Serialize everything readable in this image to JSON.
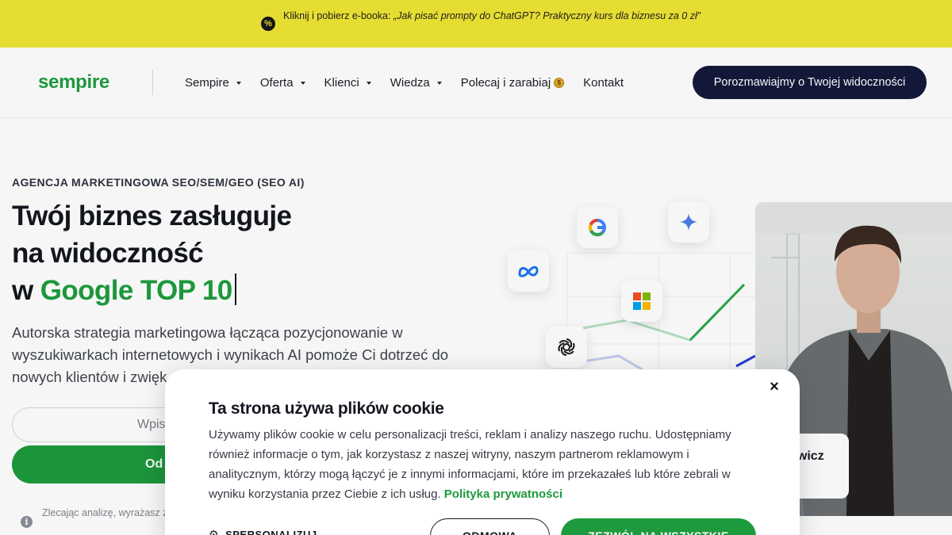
{
  "promo": {
    "icon": "percent-badge-icon",
    "lead": "Kliknij i pobierz e-booka: ",
    "title": "„Jak pisać prompty do ChatGPT? Praktyczny kurs dla biznesu za 0 zł”"
  },
  "header": {
    "logo": "sempire",
    "nav": [
      {
        "label": "Sempire",
        "has_dropdown": true
      },
      {
        "label": "Oferta",
        "has_dropdown": true
      },
      {
        "label": "Klienci",
        "has_dropdown": true
      },
      {
        "label": "Wiedza",
        "has_dropdown": true
      },
      {
        "label": "Polecaj i zarabiaj",
        "has_dropdown": false,
        "icon": "money-bag-icon"
      },
      {
        "label": "Kontakt",
        "has_dropdown": false
      }
    ],
    "cta": "Porozmawiajmy o Twojej widoczności"
  },
  "hero": {
    "eyebrow": "AGENCJA MARKETINGOWA SEO/SEM/GEO (SEO AI)",
    "headline_line1": "Twój biznes zasługuje",
    "headline_line2": "na widoczność",
    "headline_prefix": "w",
    "headline_highlight": "Google TOP 10",
    "lead": "Autorska strategia marketingowa łącząca pozycjonowanie w wyszukiwarkach internetowych i wynikach AI pomoże Ci dotrzeć do nowych klientów i zwięk",
    "input_placeholder": "Wpis",
    "submit_label": "Od",
    "consent_note": "Zlecając analizę, wyrażasz zg specjaliści przedstawią wyn",
    "person_name_fragment": "ewicz",
    "brand_icons": [
      "google-icon",
      "gemini-icon",
      "meta-icon",
      "microsoft-icon",
      "openai-icon"
    ],
    "colors": {
      "accent_green": "#1d9a3d",
      "navy": "#15193b",
      "promo_yellow": "#e6dd33"
    }
  },
  "cookie": {
    "title": "Ta strona używa plików cookie",
    "body": "Używamy plików cookie w celu personalizacji treści, reklam i analizy naszego ruchu. Udostępniamy również informacje o tym, jak korzystasz z naszej witryny, naszym partnerom reklamowym i analitycznym, którzy mogą łączyć je z innymi informacjami, które im przekazałeś lub które zebrali w wyniku korzystania przez Ciebie z ich usług. ",
    "privacy_link": "Polityka prywatności",
    "personalize": "SPERSONALIZUJ",
    "reject": "ODMOWA",
    "accept": "ZEZWÓL NA WSZYSTKIE",
    "close": "×"
  }
}
